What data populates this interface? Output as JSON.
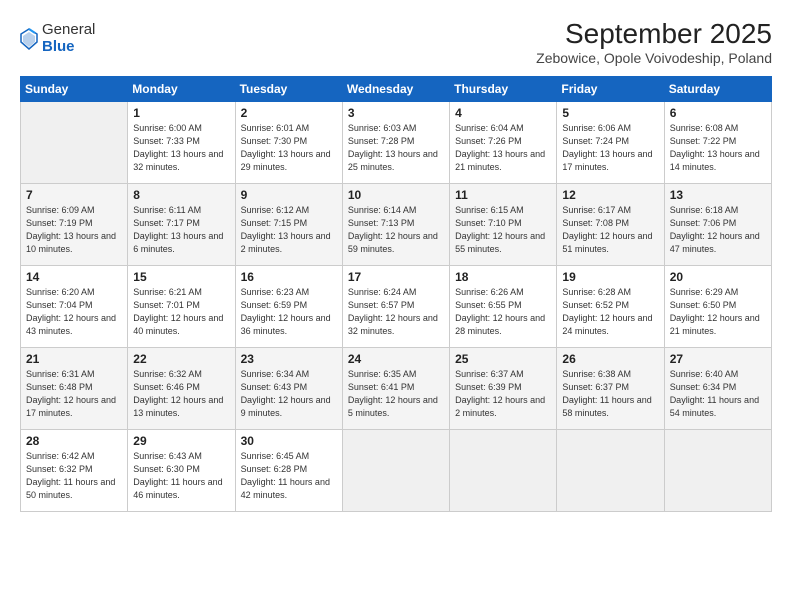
{
  "logo": {
    "general": "General",
    "blue": "Blue"
  },
  "title": "September 2025",
  "subtitle": "Zebowice, Opole Voivodeship, Poland",
  "headers": [
    "Sunday",
    "Monday",
    "Tuesday",
    "Wednesday",
    "Thursday",
    "Friday",
    "Saturday"
  ],
  "weeks": [
    [
      {
        "day": "",
        "info": ""
      },
      {
        "day": "1",
        "info": "Sunrise: 6:00 AM\nSunset: 7:33 PM\nDaylight: 13 hours\nand 32 minutes."
      },
      {
        "day": "2",
        "info": "Sunrise: 6:01 AM\nSunset: 7:30 PM\nDaylight: 13 hours\nand 29 minutes."
      },
      {
        "day": "3",
        "info": "Sunrise: 6:03 AM\nSunset: 7:28 PM\nDaylight: 13 hours\nand 25 minutes."
      },
      {
        "day": "4",
        "info": "Sunrise: 6:04 AM\nSunset: 7:26 PM\nDaylight: 13 hours\nand 21 minutes."
      },
      {
        "day": "5",
        "info": "Sunrise: 6:06 AM\nSunset: 7:24 PM\nDaylight: 13 hours\nand 17 minutes."
      },
      {
        "day": "6",
        "info": "Sunrise: 6:08 AM\nSunset: 7:22 PM\nDaylight: 13 hours\nand 14 minutes."
      }
    ],
    [
      {
        "day": "7",
        "info": "Sunrise: 6:09 AM\nSunset: 7:19 PM\nDaylight: 13 hours\nand 10 minutes."
      },
      {
        "day": "8",
        "info": "Sunrise: 6:11 AM\nSunset: 7:17 PM\nDaylight: 13 hours\nand 6 minutes."
      },
      {
        "day": "9",
        "info": "Sunrise: 6:12 AM\nSunset: 7:15 PM\nDaylight: 13 hours\nand 2 minutes."
      },
      {
        "day": "10",
        "info": "Sunrise: 6:14 AM\nSunset: 7:13 PM\nDaylight: 12 hours\nand 59 minutes."
      },
      {
        "day": "11",
        "info": "Sunrise: 6:15 AM\nSunset: 7:10 PM\nDaylight: 12 hours\nand 55 minutes."
      },
      {
        "day": "12",
        "info": "Sunrise: 6:17 AM\nSunset: 7:08 PM\nDaylight: 12 hours\nand 51 minutes."
      },
      {
        "day": "13",
        "info": "Sunrise: 6:18 AM\nSunset: 7:06 PM\nDaylight: 12 hours\nand 47 minutes."
      }
    ],
    [
      {
        "day": "14",
        "info": "Sunrise: 6:20 AM\nSunset: 7:04 PM\nDaylight: 12 hours\nand 43 minutes."
      },
      {
        "day": "15",
        "info": "Sunrise: 6:21 AM\nSunset: 7:01 PM\nDaylight: 12 hours\nand 40 minutes."
      },
      {
        "day": "16",
        "info": "Sunrise: 6:23 AM\nSunset: 6:59 PM\nDaylight: 12 hours\nand 36 minutes."
      },
      {
        "day": "17",
        "info": "Sunrise: 6:24 AM\nSunset: 6:57 PM\nDaylight: 12 hours\nand 32 minutes."
      },
      {
        "day": "18",
        "info": "Sunrise: 6:26 AM\nSunset: 6:55 PM\nDaylight: 12 hours\nand 28 minutes."
      },
      {
        "day": "19",
        "info": "Sunrise: 6:28 AM\nSunset: 6:52 PM\nDaylight: 12 hours\nand 24 minutes."
      },
      {
        "day": "20",
        "info": "Sunrise: 6:29 AM\nSunset: 6:50 PM\nDaylight: 12 hours\nand 21 minutes."
      }
    ],
    [
      {
        "day": "21",
        "info": "Sunrise: 6:31 AM\nSunset: 6:48 PM\nDaylight: 12 hours\nand 17 minutes."
      },
      {
        "day": "22",
        "info": "Sunrise: 6:32 AM\nSunset: 6:46 PM\nDaylight: 12 hours\nand 13 minutes."
      },
      {
        "day": "23",
        "info": "Sunrise: 6:34 AM\nSunset: 6:43 PM\nDaylight: 12 hours\nand 9 minutes."
      },
      {
        "day": "24",
        "info": "Sunrise: 6:35 AM\nSunset: 6:41 PM\nDaylight: 12 hours\nand 5 minutes."
      },
      {
        "day": "25",
        "info": "Sunrise: 6:37 AM\nSunset: 6:39 PM\nDaylight: 12 hours\nand 2 minutes."
      },
      {
        "day": "26",
        "info": "Sunrise: 6:38 AM\nSunset: 6:37 PM\nDaylight: 11 hours\nand 58 minutes."
      },
      {
        "day": "27",
        "info": "Sunrise: 6:40 AM\nSunset: 6:34 PM\nDaylight: 11 hours\nand 54 minutes."
      }
    ],
    [
      {
        "day": "28",
        "info": "Sunrise: 6:42 AM\nSunset: 6:32 PM\nDaylight: 11 hours\nand 50 minutes."
      },
      {
        "day": "29",
        "info": "Sunrise: 6:43 AM\nSunset: 6:30 PM\nDaylight: 11 hours\nand 46 minutes."
      },
      {
        "day": "30",
        "info": "Sunrise: 6:45 AM\nSunset: 6:28 PM\nDaylight: 11 hours\nand 42 minutes."
      },
      {
        "day": "",
        "info": ""
      },
      {
        "day": "",
        "info": ""
      },
      {
        "day": "",
        "info": ""
      },
      {
        "day": "",
        "info": ""
      }
    ]
  ]
}
